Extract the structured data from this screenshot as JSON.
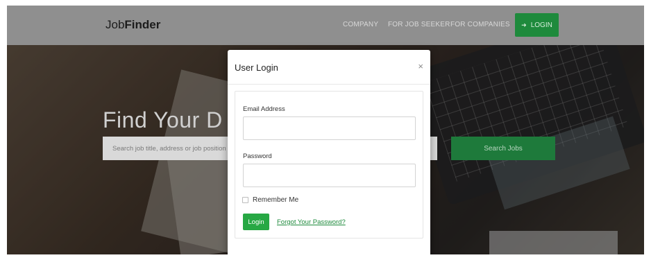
{
  "navbar": {
    "brand_light": "Job",
    "brand_bold": "Finder",
    "links": [
      "COMPANY",
      "FOR JOB SEEKER",
      "FOR COMPANIES"
    ],
    "login_label": "LOGIN",
    "login_icon": "sign-in-icon",
    "accent_color": "#1e8a3c"
  },
  "hero": {
    "title": "Find Your D",
    "search_placeholder": "Search job title, address or job position",
    "search_button": "Search Jobs"
  },
  "modal": {
    "title": "User Login",
    "close": "×",
    "email_label": "Email Address",
    "email_value": "",
    "password_label": "Password",
    "password_value": "",
    "remember_label": "Remember Me",
    "remember_checked": false,
    "login_button": "Login",
    "forgot_link": "Forgot Your Password?",
    "button_color": "#27a844"
  }
}
